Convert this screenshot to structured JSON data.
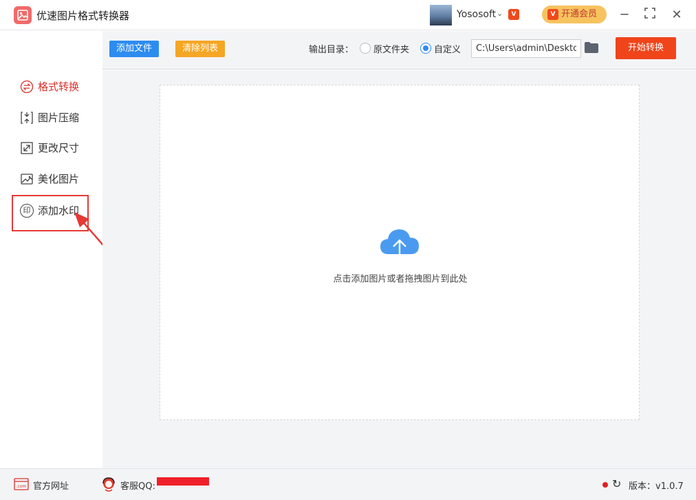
{
  "app": {
    "title": "优速图片格式转换器"
  },
  "user": {
    "name": "Yososoft",
    "vip_badge": "V"
  },
  "header": {
    "vip_button": "开通会员",
    "vip_badge": "V"
  },
  "sidebar": {
    "items": [
      {
        "label": "格式转换",
        "icon": "swap-icon",
        "active": true
      },
      {
        "label": "图片压缩",
        "icon": "compress-icon",
        "active": false
      },
      {
        "label": "更改尺寸",
        "icon": "resize-icon",
        "active": false
      },
      {
        "label": "美化图片",
        "icon": "beautify-icon",
        "active": false
      },
      {
        "label": "添加水印",
        "icon": "watermark-icon",
        "active": false
      }
    ],
    "watermark_icon_glyph": "印"
  },
  "toolbar": {
    "add_files": "添加文件",
    "clear_list": "清除列表",
    "output_label": "输出目录：",
    "option_original": "原文件夹",
    "option_custom": "自定义",
    "selected_option": "custom",
    "output_path": "C:\\Users\\admin\\Desktop",
    "start": "开始转换"
  },
  "main": {
    "drop_hint": "点击添加图片或者拖拽图片到此处"
  },
  "footer": {
    "website_icon_text": ".com",
    "website": "官方网址",
    "support": "客服QQ:",
    "version": "版本：v1.0.7"
  },
  "colors": {
    "accent_blue": "#2d8cf0",
    "accent_orange": "#f5a623",
    "start_red": "#f0441a",
    "active_red": "#d9302a",
    "vip_gold": "#f7c35f"
  }
}
